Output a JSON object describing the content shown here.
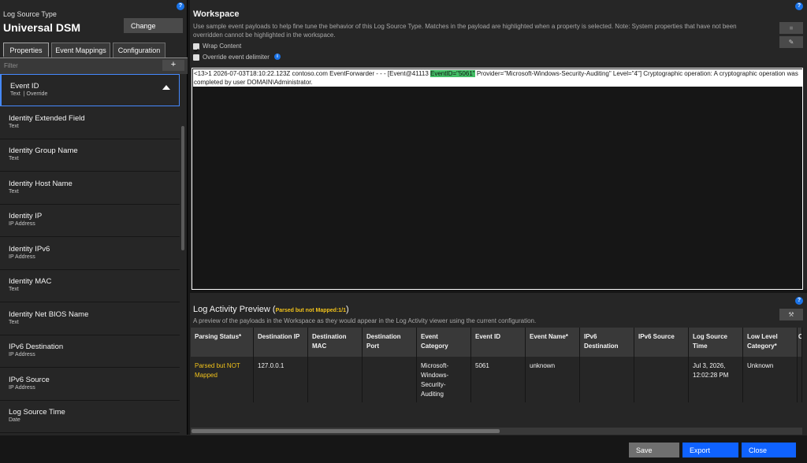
{
  "left": {
    "label": "Log Source Type",
    "name": "Universal DSM",
    "change_button": "Change",
    "tabs": [
      "Properties",
      "Event Mappings",
      "Configuration"
    ],
    "filter_placeholder": "Filter",
    "add_button": "+",
    "items": [
      {
        "name": "Event ID",
        "type": "Text",
        "override": "Override"
      },
      {
        "name": "Identity Extended Field",
        "type": "Text"
      },
      {
        "name": "Identity Group Name",
        "type": "Text"
      },
      {
        "name": "Identity Host Name",
        "type": "Text"
      },
      {
        "name": "Identity IP",
        "type": "IP Address"
      },
      {
        "name": "Identity IPv6",
        "type": "IP Address"
      },
      {
        "name": "Identity MAC",
        "type": "Text"
      },
      {
        "name": "Identity Net BIOS Name",
        "type": "Text"
      },
      {
        "name": "IPv6 Destination",
        "type": "IP Address"
      },
      {
        "name": "IPv6 Source",
        "type": "IP Address"
      },
      {
        "name": "Log Source Time",
        "type": "Date"
      }
    ]
  },
  "workspace": {
    "title": "Workspace",
    "description": "Use sample event payloads to help fine tune the behavior of this Log Source Type. Matches in the payload are highlighted when a property is selected. Note: System properties that have not been overridden cannot be highlighted in the workspace.",
    "wrap_content": "Wrap Content",
    "override_delimiter": "Override event delimiter",
    "payload_before": "<13>1 2026-07-03T18:10:22.123Z contoso.com EventForwarder - - - [Event@41113 ",
    "payload_highlight": "EventID=\"5061\"",
    "payload_after": " Provider=\"Microsoft-Windows-Security-Auditing\" Level=\"4\"] Cryptographic operation: A cryptographic operation was completed by user DOMAIN\\Administrator."
  },
  "preview": {
    "title": "Log Activity Preview",
    "badge": "Parsed but not Mapped:1/1",
    "description": "A preview of the payloads in the Workspace as they would appear in the Log Activity viewer using the current configuration.",
    "columns": [
      "Parsing Status*",
      "Destination IP",
      "Destination MAC",
      "Destination Port",
      "Event Category",
      "Event ID",
      "Event Name*",
      "IPv6 Destination",
      "IPv6 Source",
      "Log Source Time",
      "Low Level Category*",
      "C"
    ],
    "row": [
      "Parsed but NOT Mapped",
      "127.0.0.1",
      "",
      "",
      "Microsoft-Windows-Security-Auditing",
      "5061",
      "unknown",
      "",
      "",
      "Jul 3, 2026, 12:02:28 PM",
      "Unknown",
      ""
    ]
  },
  "footer": {
    "save": "Save",
    "export": "Export",
    "close": "Close"
  },
  "colors": {
    "accent": "#0f62fe",
    "highlight": "#42be65",
    "warning": "#f1c21b"
  }
}
